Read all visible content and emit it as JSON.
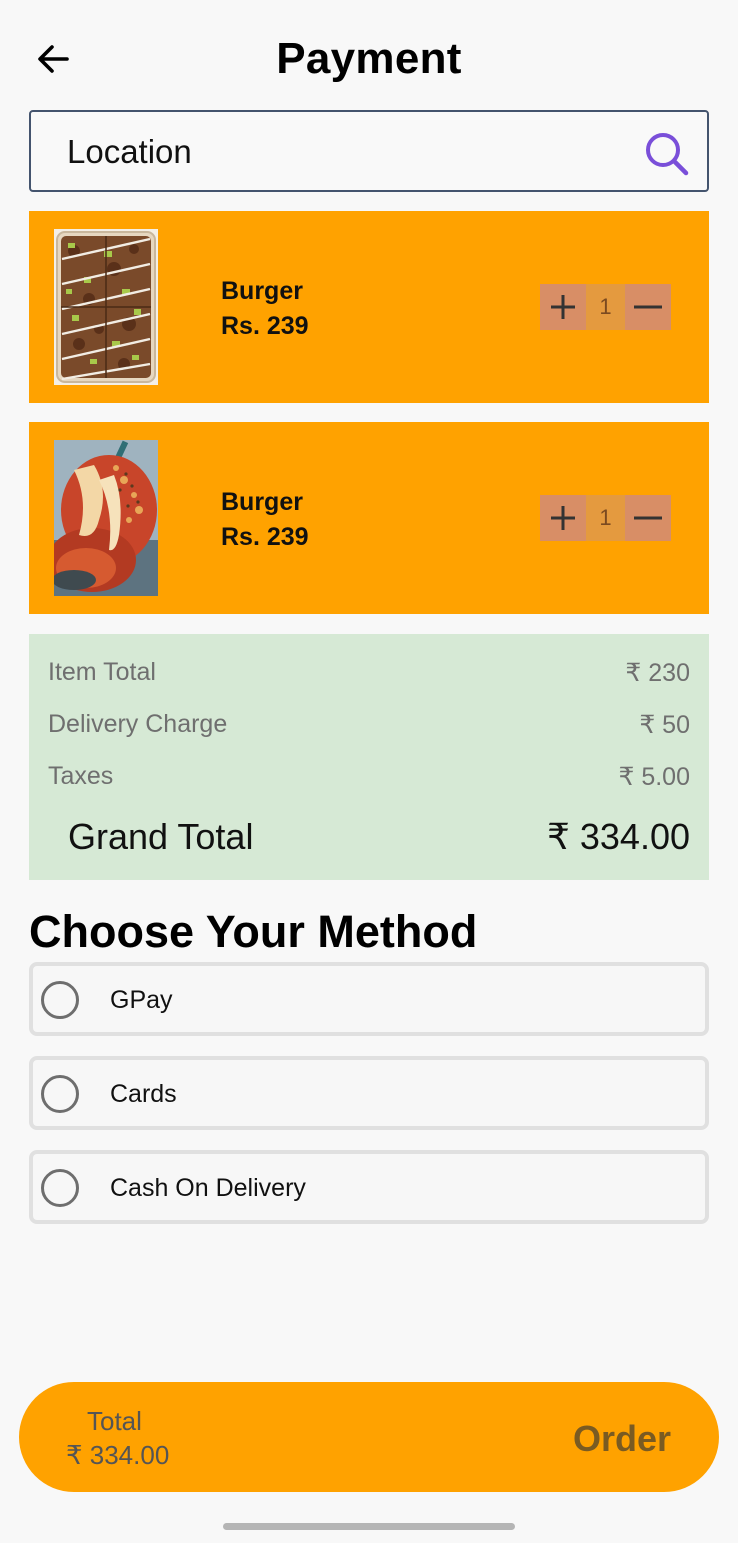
{
  "header": {
    "title": "Payment",
    "back_icon": "arrow-left-icon"
  },
  "location": {
    "placeholder": "Location",
    "search_icon": "search-icon",
    "accent": "#7a4fd9"
  },
  "cart": {
    "items": [
      {
        "name": "Burger",
        "price": "Rs. 239",
        "qty": "1",
        "image": "food-tray-image"
      },
      {
        "name": "Burger",
        "price": "Rs. 239",
        "qty": "1",
        "image": "food-skillet-image"
      }
    ],
    "plus_icon": "plus-icon",
    "minus_icon": "minus-icon"
  },
  "bill": {
    "item_total_label": "Item Total",
    "item_total_value": "₹ 230",
    "delivery_label": "Delivery Charge",
    "delivery_value": "₹ 50",
    "taxes_label": "Taxes",
    "taxes_value": "₹ 5.00",
    "grand_label": "Grand Total",
    "grand_value": "₹ 334.00"
  },
  "payment": {
    "title": "Choose Your Method",
    "methods": [
      {
        "label": "GPay",
        "selected": false
      },
      {
        "label": "Cards",
        "selected": false
      },
      {
        "label": "Cash On Delivery",
        "selected": false
      }
    ]
  },
  "order_bar": {
    "total_label": "Total",
    "total_value": "₹ 334.00",
    "order_label": "Order"
  },
  "colors": {
    "accent_orange": "#ffa200",
    "bill_bg": "#d6e9d5",
    "search_purple": "#7a4fd9"
  }
}
